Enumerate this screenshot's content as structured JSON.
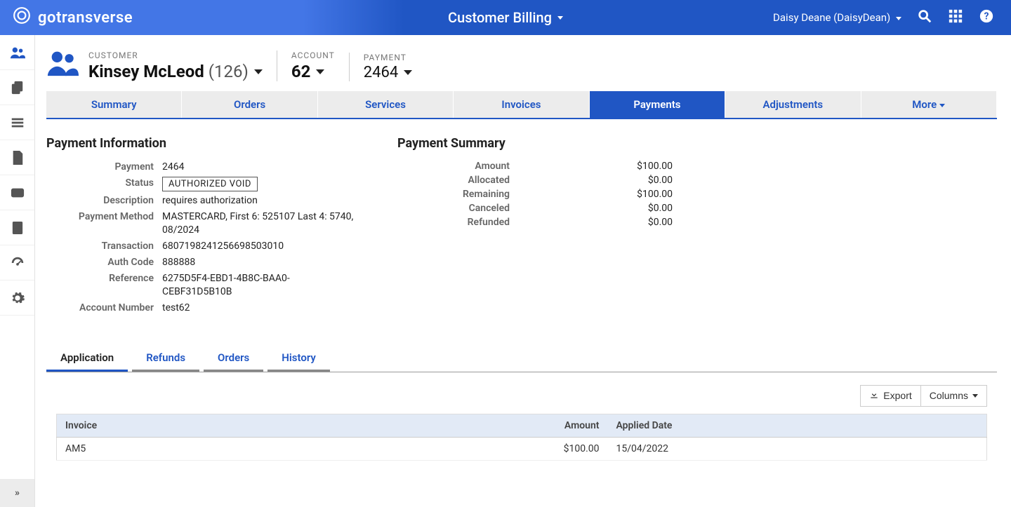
{
  "brand": "gotransverse",
  "page_title": "Customer Billing",
  "user": {
    "display": "Daisy Deane (DaisyDean)"
  },
  "context": {
    "customer_label": "CUSTOMER",
    "customer_name": "Kinsey McLeod",
    "customer_id": "(126)",
    "account_label": "ACCOUNT",
    "account_value": "62",
    "payment_label": "PAYMENT",
    "payment_value": "2464"
  },
  "main_tabs": [
    "Summary",
    "Orders",
    "Services",
    "Invoices",
    "Payments",
    "Adjustments",
    "More"
  ],
  "payment_info": {
    "heading": "Payment Information",
    "rows": [
      {
        "label": "Payment",
        "value": "2464"
      },
      {
        "label": "Status",
        "value": "AUTHORIZED VOID",
        "badge": true
      },
      {
        "label": "Description",
        "value": "requires authorization"
      },
      {
        "label": "Payment Method",
        "value": "MASTERCARD, First 6: 525107 Last 4: 5740, 08/2024"
      },
      {
        "label": "Transaction",
        "value": "6807198241256698503010"
      },
      {
        "label": "Auth Code",
        "value": "888888"
      },
      {
        "label": "Reference",
        "value": "6275D5F4-EBD1-4B8C-BAA0-CEBF31D5B10B"
      },
      {
        "label": "Account Number",
        "value": "test62"
      }
    ]
  },
  "payment_summary": {
    "heading": "Payment Summary",
    "rows": [
      {
        "label": "Amount",
        "value": "$100.00"
      },
      {
        "label": "Allocated",
        "value": "$0.00"
      },
      {
        "label": "Remaining",
        "value": "$100.00"
      },
      {
        "label": "Canceled",
        "value": "$0.00"
      },
      {
        "label": "Refunded",
        "value": "$0.00"
      }
    ]
  },
  "sub_tabs": [
    "Application",
    "Refunds",
    "Orders",
    "History"
  ],
  "toolbar": {
    "export": "Export",
    "columns": "Columns"
  },
  "table": {
    "headers": {
      "invoice": "Invoice",
      "amount": "Amount",
      "applied": "Applied Date"
    },
    "rows": [
      {
        "invoice": "AM5",
        "amount": "$100.00",
        "applied": "15/04/2022"
      }
    ]
  }
}
